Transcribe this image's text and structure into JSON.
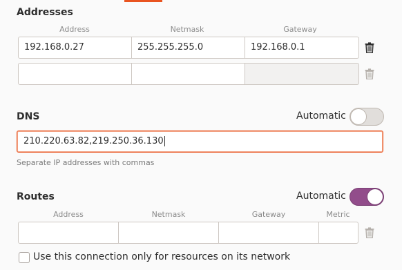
{
  "addresses": {
    "title": "Addresses",
    "columns": [
      "Address",
      "Netmask",
      "Gateway"
    ],
    "rows": [
      {
        "address": "192.168.0.27",
        "netmask": "255.255.255.0",
        "gateway": "192.168.0.1"
      },
      {
        "address": "",
        "netmask": "",
        "gateway": ""
      }
    ],
    "delete_icon": "trash-icon"
  },
  "dns": {
    "title": "DNS",
    "automatic_label": "Automatic",
    "automatic_on": false,
    "value": "210.220.63.82,219.250.36.130",
    "hint": "Separate IP addresses with commas"
  },
  "routes": {
    "title": "Routes",
    "automatic_label": "Automatic",
    "automatic_on": true,
    "columns": [
      "Address",
      "Netmask",
      "Gateway",
      "Metric"
    ],
    "rows": [
      {
        "address": "",
        "netmask": "",
        "gateway": "",
        "metric": ""
      }
    ]
  },
  "restrict": {
    "label": "Use this connection only for resources on its network",
    "checked": false
  },
  "colors": {
    "accent_orange": "#e95420",
    "toggle_on": "#924d8b"
  }
}
